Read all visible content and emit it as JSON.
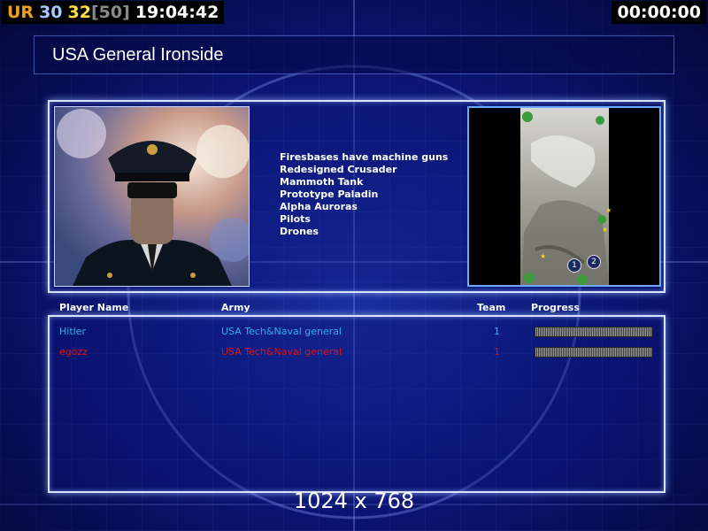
{
  "hud": {
    "tag": "UR",
    "val_a": "30",
    "val_b": "32",
    "val_c": "[50]",
    "clock": "19:04:42",
    "timer": "00:00:00",
    "colors": {
      "tag": "#f0a020",
      "a": "#a8c8ff",
      "b": "#ffe040",
      "c": "#8a8a8a",
      "clock": "#ffffff"
    }
  },
  "title": "USA General Ironside",
  "features": [
    "Firesbases have machine guns",
    "Redesigned Crusader",
    "Mammoth Tank",
    "Prototype Paladin",
    "Alpha Auroras",
    "Pilots",
    "Drones"
  ],
  "minimap": {
    "markers": [
      "1",
      "2"
    ]
  },
  "table": {
    "headers": {
      "player": "Player Name",
      "army": "Army",
      "team": "Team",
      "progress": "Progress"
    },
    "rows": [
      {
        "player": "Hitler",
        "army": "USA Tech&Naval general",
        "team": "1",
        "progress": 1.0,
        "color": "#2ab0e8"
      },
      {
        "player": "egozz",
        "army": "USA Tech&Naval general",
        "team": "1",
        "progress": 1.0,
        "color": "#e01010"
      }
    ]
  },
  "resolution": "1024 x 768",
  "colors": {
    "accent": "#d8e4ff",
    "background": "#0b1470"
  }
}
